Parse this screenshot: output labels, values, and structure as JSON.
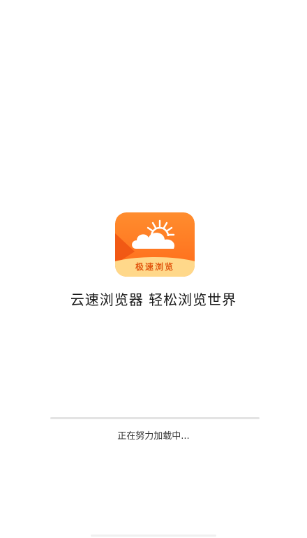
{
  "app_icon": {
    "label": "极速浏览",
    "icon": "cloud-sun-icon",
    "colors": {
      "background_top": "#ff8a2a",
      "background_bottom": "#ff6a1a",
      "accent_stripe": "#ef5a14",
      "label_band": "#ffd98a",
      "cloud": "#ffffff",
      "sun_rays": "#ffffff"
    }
  },
  "splash": {
    "slogan": "云速浏览器 轻松浏览世界"
  },
  "loading": {
    "text": "正在努力加载中...",
    "progress": 0
  }
}
